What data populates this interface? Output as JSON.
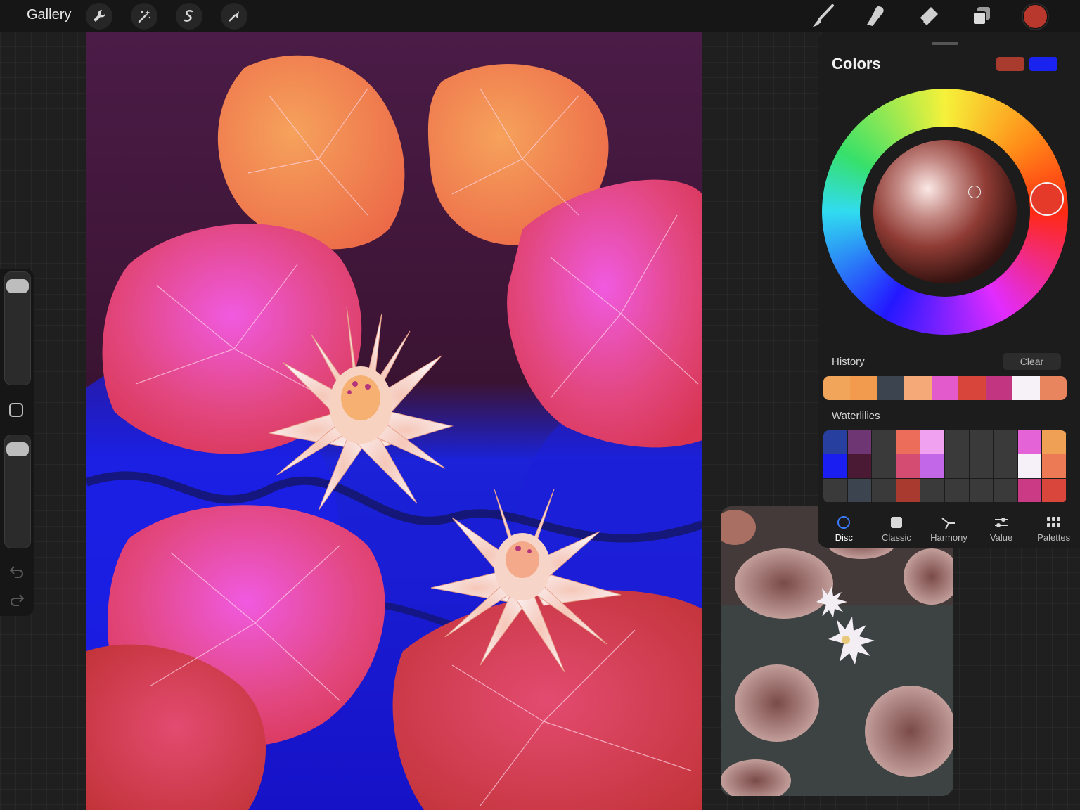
{
  "topbar": {
    "gallery_label": "Gallery",
    "left_tools": [
      "wrench-icon",
      "magic-wand-icon",
      "selection-icon",
      "transform-arrow-icon"
    ],
    "right_tools": [
      "brush-icon",
      "smudge-icon",
      "eraser-icon",
      "layers-icon"
    ],
    "current_color": "#B9382D"
  },
  "colors_panel": {
    "title": "Colors",
    "primary_swatch": "#A83A2E",
    "secondary_swatch": "#1A22F0",
    "history_label": "History",
    "clear_label": "Clear",
    "history_colors": [
      "#F0A55A",
      "#F29A4E",
      "#3C4450",
      "#F5A878",
      "#E25ACB",
      "#D8453A",
      "#C23581",
      "#F6F2F7",
      "#E9855E"
    ],
    "palette_name": "Waterlilies",
    "palette_colors": [
      "#27409F",
      "#6E3672",
      "#3A3A3A",
      "#EC6E5A",
      "#F0A2F0",
      "#3A3A3A",
      "#3A3A3A",
      "#3A3A3A",
      "#E463D6",
      "#F0A055",
      "#1B1EF0",
      "#4A1A35",
      "#3A3A3A",
      "#D54C73",
      "#C267E8",
      "#3A3A3A",
      "#3A3A3A",
      "#3A3A3A",
      "#F6F1F8",
      "#EB7A55",
      "#3A3A3A",
      "#3C4450",
      "#3A3A3A",
      "#A93A30",
      "#3A3A3A",
      "#3A3A3A",
      "#3A3A3A",
      "#3A3A3A",
      "#CA3A85",
      "#D8463C"
    ],
    "tabs": [
      {
        "label": "Disc",
        "icon": "disc-icon"
      },
      {
        "label": "Classic",
        "icon": "square-icon"
      },
      {
        "label": "Harmony",
        "icon": "harmony-icon"
      },
      {
        "label": "Value",
        "icon": "sliders-icon"
      },
      {
        "label": "Palettes",
        "icon": "grid-icon"
      }
    ],
    "active_tab": "Disc"
  }
}
